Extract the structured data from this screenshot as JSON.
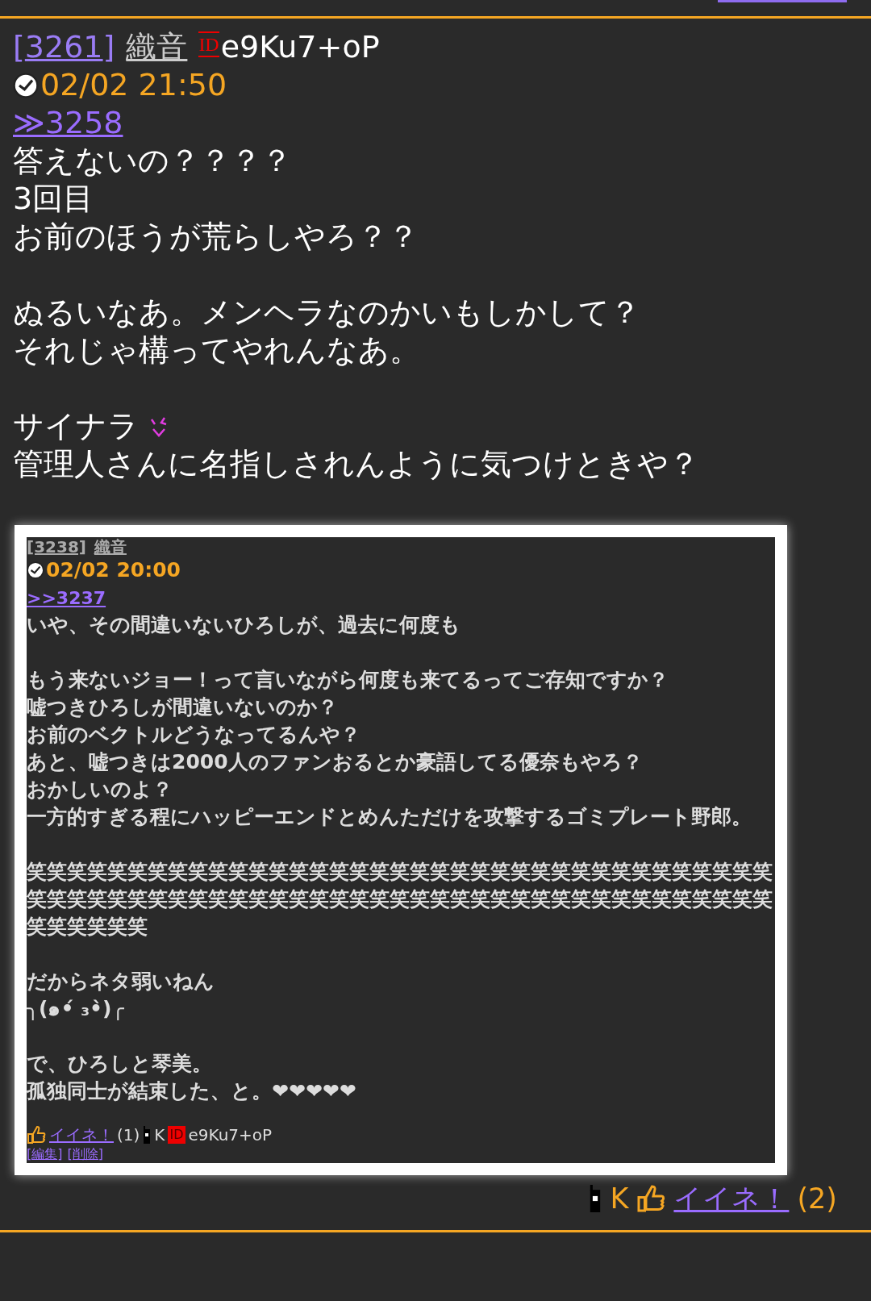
{
  "post": {
    "brackets": [
      "[",
      "]"
    ],
    "number": "3261",
    "name": "織音",
    "id_label": "ID",
    "id": "e9Ku7+oP",
    "date": "02/02 21:50",
    "reply_to": "≫3258",
    "blocks": [
      [
        {
          "text": "答えないの？？？？",
          "kind": "plain"
        },
        {
          "text": "3回目",
          "kind": "plain"
        },
        {
          "text": "お前のほうが荒らしやろ？？",
          "kind": "plain"
        }
      ],
      [
        {
          "text": "ぬるいなあ。メンヘラなのかいもしかして？",
          "kind": "plain"
        },
        {
          "text": "それじゃ構ってやれんなあ。",
          "kind": "plain"
        }
      ],
      [
        {
          "text": "サイナラ",
          "kind": "emote"
        },
        {
          "text": "管理人さんに名指しされんように気つけときや？",
          "kind": "plain"
        }
      ]
    ],
    "screenshot": {
      "number": "[3238]",
      "name": "織音",
      "date": "02/02 20:00",
      "reply_to": ">>3237",
      "blocks": [
        [
          "いや、その間違いないひろしが、過去に何度も"
        ],
        [
          "もう来ないジョー！って言いながら何度も来てるってご存知ですか？",
          "嘘つきひろしが間違いないのか？",
          "お前のベクトルどうなってるんや？",
          "あと、嘘つきは2000人のファンおるとか豪語してる優奈もやろ？",
          "おかしいのよ？",
          "一方的すぎる程にハッピーエンドとめんただけを攻撃するゴミプレート野郎。"
        ],
        [
          "笑笑笑笑笑笑笑笑笑笑笑笑笑笑笑笑笑笑笑笑笑笑笑笑笑笑笑笑笑笑笑笑笑笑笑笑笑笑笑笑笑笑笑笑笑笑笑笑笑笑笑笑笑笑笑笑笑笑笑笑笑笑笑笑笑笑笑笑笑笑笑笑笑笑笑笑笑笑笑笑"
        ],
        [
          "だからネタ弱いねん",
          "╮(๑•́ ₃•̀)╭"
        ],
        [
          "で、ひろしと琴美。",
          "孤独同士が結束した、と。❤❤❤❤❤"
        ]
      ],
      "like": "イイネ！",
      "like_count": "(1)",
      "carrier": "K",
      "id_label": "ID",
      "id": "e9Ku7+oP",
      "actions": [
        "[編集]",
        "[削除]"
      ]
    },
    "carrier": "K",
    "like": "イイネ！",
    "like_count": "(2)"
  }
}
